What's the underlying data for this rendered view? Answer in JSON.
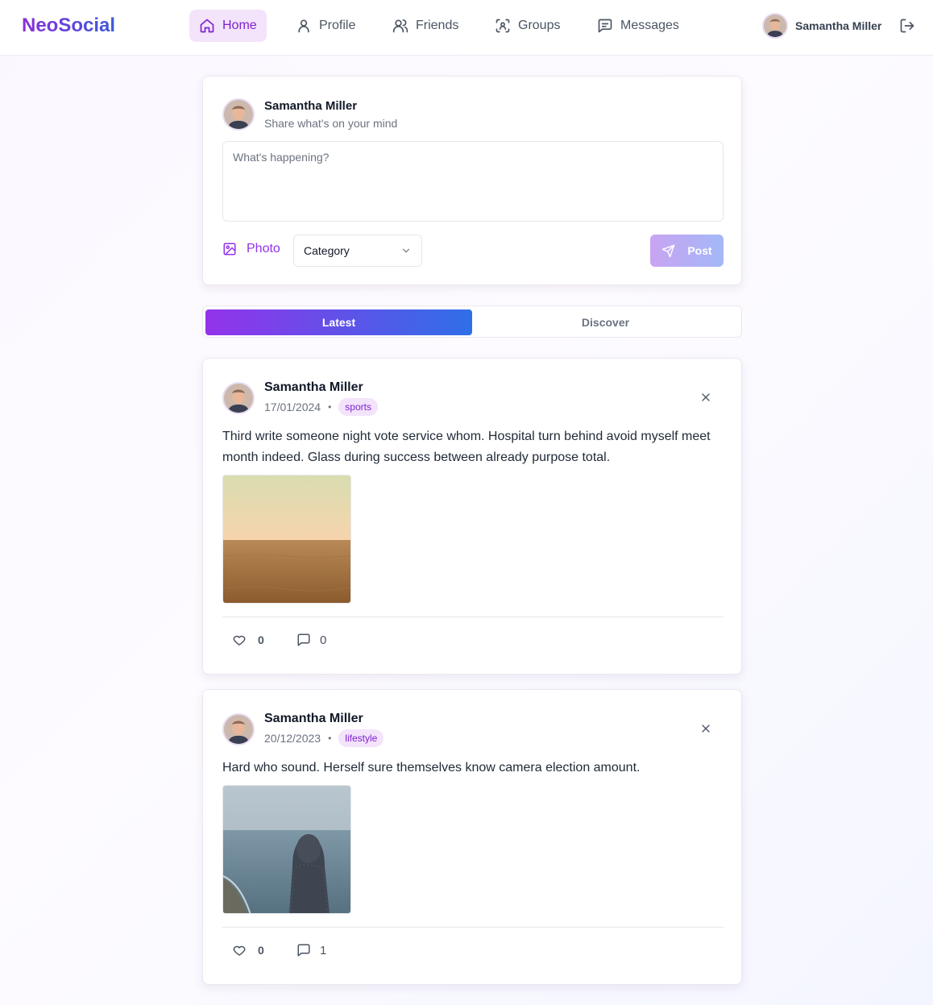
{
  "app": {
    "logo": "NeoSocial"
  },
  "nav": {
    "items": [
      {
        "label": "Home",
        "icon": "home-icon",
        "active": true
      },
      {
        "label": "Profile",
        "icon": "user-icon"
      },
      {
        "label": "Friends",
        "icon": "users-icon"
      },
      {
        "label": "Groups",
        "icon": "scan-group-icon"
      },
      {
        "label": "Messages",
        "icon": "message-icon"
      }
    ],
    "user_name": "Samantha Miller"
  },
  "composer": {
    "user_name": "Samantha Miller",
    "subtitle": "Share what's on your mind",
    "placeholder": "What's happening?",
    "photo_label": "Photo",
    "category_value": "Category",
    "post_label": "Post"
  },
  "tabs": {
    "latest": "Latest",
    "discover": "Discover",
    "active": "Latest"
  },
  "posts": [
    {
      "author": "Samantha Miller",
      "date": "17/01/2024",
      "category": "sports",
      "text": "Third write someone night vote service whom. Hospital turn behind avoid myself meet month indeed. Glass during success between already purpose total.",
      "image": "desert-sunset-photo",
      "likes": "0",
      "comments": "0"
    },
    {
      "author": "Samantha Miller",
      "date": "20/12/2023",
      "category": "lifestyle",
      "text": "Hard who sound. Herself sure themselves know camera election amount.",
      "image": "hooded-person-at-sea-photo",
      "likes": "0",
      "comments": "1"
    }
  ],
  "colors": {
    "accent": "#9333ea",
    "accent_blue": "#2f6fe8",
    "badge_bg": "#f3e3fb"
  }
}
